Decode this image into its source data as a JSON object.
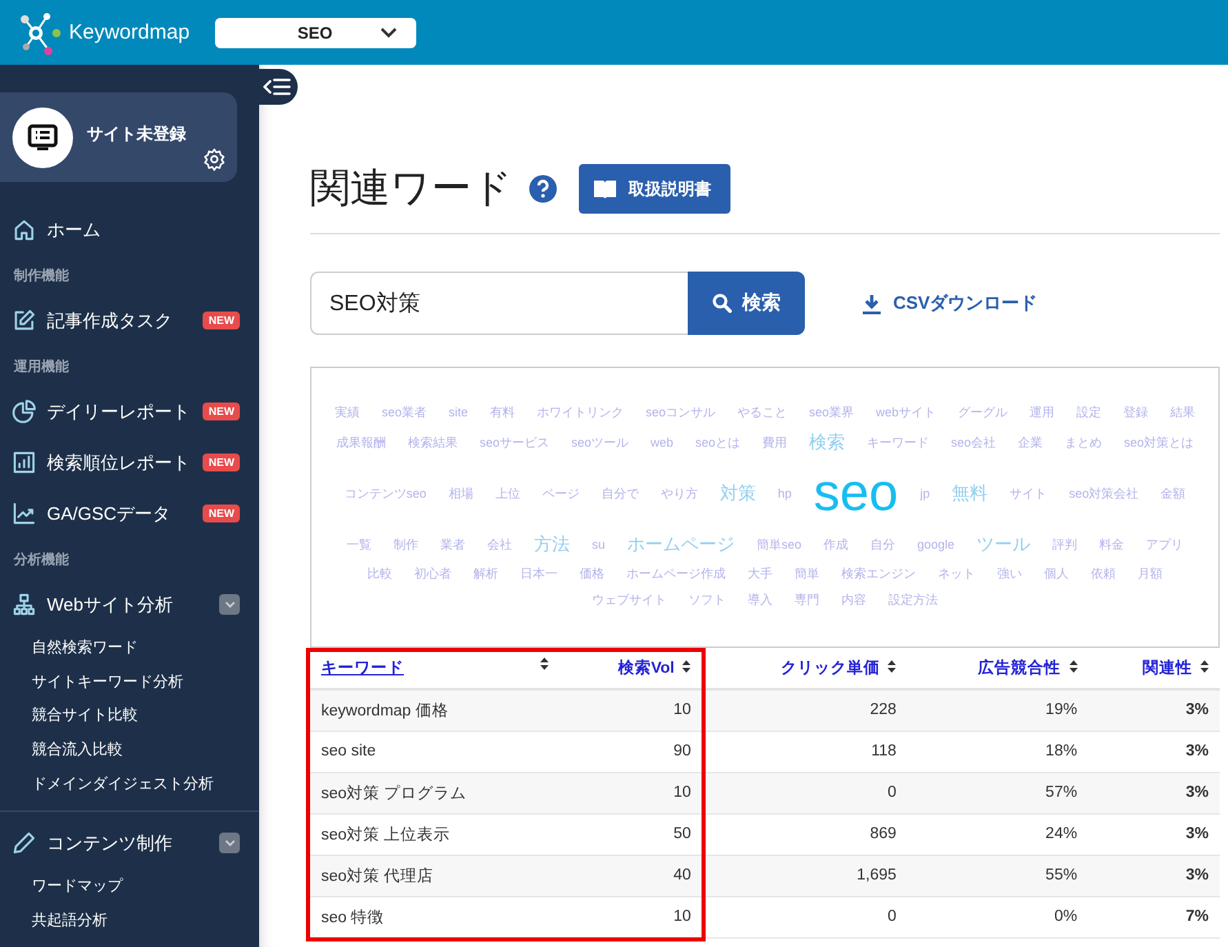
{
  "top_bar": {
    "logo_text": "Keywordmap",
    "project_select": {
      "value": "SEO"
    }
  },
  "sidebar": {
    "site_card": {
      "label": "サイト未登録"
    },
    "items": [
      {
        "kind": "link",
        "label": "ホーム"
      },
      {
        "kind": "section",
        "label": "制作機能"
      },
      {
        "kind": "link",
        "label": "記事作成タスク",
        "badge": "NEW"
      },
      {
        "kind": "section",
        "label": "運用機能"
      },
      {
        "kind": "link",
        "label": "デイリーレポート",
        "badge": "NEW"
      },
      {
        "kind": "link",
        "label": "検索順位レポート",
        "badge": "NEW"
      },
      {
        "kind": "link",
        "label": "GA/GSCデータ",
        "badge": "NEW"
      },
      {
        "kind": "section",
        "label": "分析機能"
      },
      {
        "kind": "group",
        "label": "Webサイト分析",
        "expanded": true,
        "children": [
          {
            "label": "自然検索ワード"
          },
          {
            "label": "サイトキーワード分析"
          },
          {
            "label": "競合サイト比較"
          },
          {
            "label": "競合流入比較"
          },
          {
            "label": "ドメインダイジェスト分析"
          }
        ]
      },
      {
        "kind": "group",
        "label": "コンテンツ制作",
        "expanded": true,
        "children": [
          {
            "label": "ワードマップ"
          },
          {
            "label": "共起語分析"
          }
        ]
      }
    ]
  },
  "page": {
    "title": "関連ワード",
    "manual_button": "取扱説明書"
  },
  "search": {
    "value": "SEO対策",
    "button": "検索",
    "csv_link": "CSVダウンロード"
  },
  "word_cloud": [
    {
      "text": "実績",
      "kind": "small"
    },
    {
      "text": "seo業者",
      "kind": "small"
    },
    {
      "text": "site",
      "kind": "small"
    },
    {
      "text": "有料",
      "kind": "small"
    },
    {
      "text": "ホワイトリンク",
      "kind": "small"
    },
    {
      "text": "seoコンサル",
      "kind": "small"
    },
    {
      "text": "やること",
      "kind": "small"
    },
    {
      "text": "seo業界",
      "kind": "small"
    },
    {
      "text": "webサイト",
      "kind": "small"
    },
    {
      "text": "グーグル",
      "kind": "small"
    },
    {
      "text": "運用",
      "kind": "small"
    },
    {
      "text": "設定",
      "kind": "small"
    },
    {
      "text": "登録",
      "kind": "small"
    },
    {
      "text": "結果",
      "kind": "small"
    },
    {
      "text": "成果報酬",
      "kind": "small"
    },
    {
      "text": "検索結果",
      "kind": "small"
    },
    {
      "text": "seoサービス",
      "kind": "small"
    },
    {
      "text": "seoツール",
      "kind": "small"
    },
    {
      "text": "web",
      "kind": "small"
    },
    {
      "text": "seoとは",
      "kind": "small"
    },
    {
      "text": "費用",
      "kind": "small"
    },
    {
      "text": "検索",
      "kind": "medium"
    },
    {
      "text": "キーワード",
      "kind": "small"
    },
    {
      "text": "seo会社",
      "kind": "small"
    },
    {
      "text": "企業",
      "kind": "small"
    },
    {
      "text": "まとめ",
      "kind": "small"
    },
    {
      "text": "seo対策とは",
      "kind": "small"
    },
    {
      "text": "コンテンツseo",
      "kind": "small"
    },
    {
      "text": "相場",
      "kind": "small"
    },
    {
      "text": "上位",
      "kind": "small"
    },
    {
      "text": "ページ",
      "kind": "small"
    },
    {
      "text": "自分で",
      "kind": "small"
    },
    {
      "text": "やり方",
      "kind": "small"
    },
    {
      "text": "対策",
      "kind": "medium"
    },
    {
      "text": "hp",
      "kind": "small"
    },
    {
      "text": "seo",
      "kind": "main"
    },
    {
      "text": "jp",
      "kind": "small"
    },
    {
      "text": "無料",
      "kind": "medium"
    },
    {
      "text": "サイト",
      "kind": "small"
    },
    {
      "text": "seo対策会社",
      "kind": "small"
    },
    {
      "text": "金額",
      "kind": "small"
    },
    {
      "text": "一覧",
      "kind": "small"
    },
    {
      "text": "制作",
      "kind": "small"
    },
    {
      "text": "業者",
      "kind": "small"
    },
    {
      "text": "会社",
      "kind": "small"
    },
    {
      "text": "方法",
      "kind": "medium"
    },
    {
      "text": "su",
      "kind": "small"
    },
    {
      "text": "ホームページ",
      "kind": "medium"
    },
    {
      "text": "簡単seo",
      "kind": "small"
    },
    {
      "text": "作成",
      "kind": "small"
    },
    {
      "text": "自分",
      "kind": "small"
    },
    {
      "text": "google",
      "kind": "small"
    },
    {
      "text": "ツール",
      "kind": "medium"
    },
    {
      "text": "評判",
      "kind": "small"
    },
    {
      "text": "料金",
      "kind": "small"
    },
    {
      "text": "アプリ",
      "kind": "small"
    },
    {
      "text": "比較",
      "kind": "small"
    },
    {
      "text": "初心者",
      "kind": "small"
    },
    {
      "text": "解析",
      "kind": "small"
    },
    {
      "text": "日本一",
      "kind": "small"
    },
    {
      "text": "価格",
      "kind": "small"
    },
    {
      "text": "ホームページ作成",
      "kind": "small"
    },
    {
      "text": "大手",
      "kind": "small"
    },
    {
      "text": "簡単",
      "kind": "small"
    },
    {
      "text": "検索エンジン",
      "kind": "small"
    },
    {
      "text": "ネット",
      "kind": "small"
    },
    {
      "text": "強い",
      "kind": "small"
    },
    {
      "text": "個人",
      "kind": "small"
    },
    {
      "text": "依頼",
      "kind": "small"
    },
    {
      "text": "月額",
      "kind": "small"
    },
    {
      "text": "ウェブサイト",
      "kind": "small"
    },
    {
      "text": "ソフト",
      "kind": "small"
    },
    {
      "text": "導入",
      "kind": "small"
    },
    {
      "text": "専門",
      "kind": "small"
    },
    {
      "text": "内容",
      "kind": "small"
    },
    {
      "text": "設定方法",
      "kind": "small"
    }
  ],
  "table": {
    "columns": [
      {
        "label": "キーワード",
        "sorted": true,
        "highlighted": true
      },
      {
        "label": "検索Vol",
        "sorted": false,
        "highlighted": true
      },
      {
        "label": "クリック単価",
        "sorted": false,
        "highlighted": false
      },
      {
        "label": "広告競合性",
        "sorted": false,
        "highlighted": false
      },
      {
        "label": "関連性",
        "sorted": false,
        "highlighted": false
      }
    ],
    "rows": [
      [
        "keywordmap 価格",
        "10",
        "228",
        "19%",
        "3%"
      ],
      [
        "seo site",
        "90",
        "118",
        "18%",
        "3%"
      ],
      [
        "seo対策 プログラム",
        "10",
        "0",
        "57%",
        "3%"
      ],
      [
        "seo対策 上位表示",
        "50",
        "869",
        "24%",
        "3%"
      ],
      [
        "seo対策 代理店",
        "40",
        "1,695",
        "55%",
        "3%"
      ],
      [
        "seo 特徴",
        "10",
        "0",
        "0%",
        "7%"
      ]
    ]
  }
}
